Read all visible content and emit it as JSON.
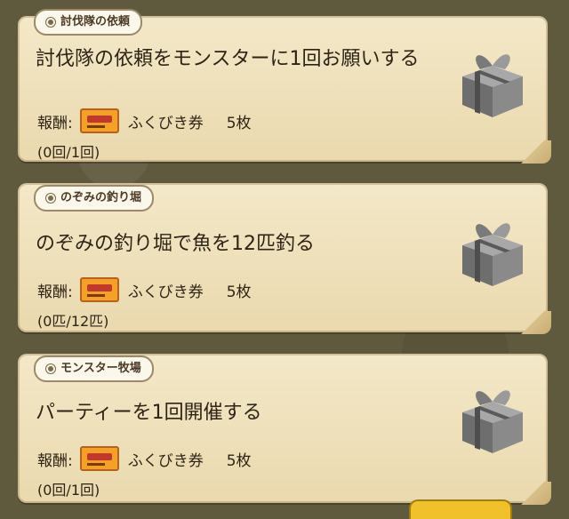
{
  "quests": [
    {
      "tag": "討伐隊の依頼",
      "title": "討伐隊の依頼をモンスターに1回お願いする",
      "reward_label": "報酬:",
      "reward_item": "ふくびき券",
      "reward_qty": "5枚",
      "progress": "(0回/1回)"
    },
    {
      "tag": "のぞみの釣り堀",
      "title": "のぞみの釣り堀で魚を12匹釣る",
      "reward_label": "報酬:",
      "reward_item": "ふくびき券",
      "reward_qty": "5枚",
      "progress": "(0匹/12匹)"
    },
    {
      "tag": "モンスター牧場",
      "title": "パーティーを1回開催する",
      "reward_label": "報酬:",
      "reward_item": "ふくびき券",
      "reward_qty": "5枚",
      "progress": "(0回/1回)"
    }
  ],
  "icons": {
    "reward": "ticket-icon",
    "gift": "gift-box-icon"
  },
  "colors": {
    "card": "#ead9ae",
    "ticket": "#f4a02a",
    "gift": "#8a8a8a"
  }
}
